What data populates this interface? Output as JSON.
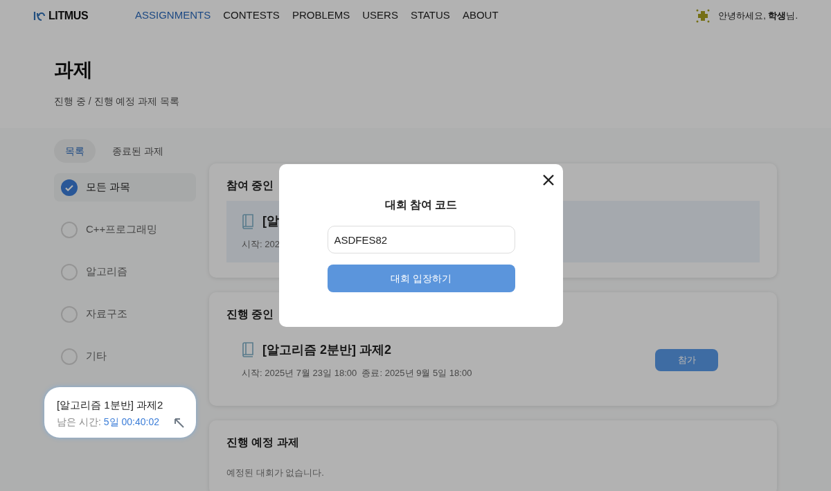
{
  "header": {
    "logo": "LITMUS",
    "nav": [
      {
        "label": "ASSIGNMENTS",
        "selected": true
      },
      {
        "label": "CONTESTS",
        "selected": false
      },
      {
        "label": "PROBLEMS",
        "selected": false
      },
      {
        "label": "USERS",
        "selected": false
      },
      {
        "label": "STATUS",
        "selected": false
      },
      {
        "label": "ABOUT",
        "selected": false
      }
    ],
    "greeting": "안녕하세요, **학생**님."
  },
  "page": {
    "title": "과제",
    "subtitle": "진행 중 / 진행 예정 과제 목록"
  },
  "tabs": [
    {
      "label": "목록",
      "selected": true
    },
    {
      "label": "종료된 과제",
      "selected": false
    }
  ],
  "filters": [
    {
      "label": "모든 과목",
      "checked": true
    },
    {
      "label": "C++프로그래밍",
      "checked": false
    },
    {
      "label": "알고리즘",
      "checked": false
    },
    {
      "label": "자료구조",
      "checked": false
    },
    {
      "label": "기타",
      "checked": false
    }
  ],
  "sections": [
    {
      "title": "참여 중인",
      "highlighted": true,
      "items": [
        {
          "title": "[알",
          "dates": "시작: 202"
        }
      ]
    },
    {
      "title": "진행 중인",
      "items": [
        {
          "title": "[알고리즘 2분반] 과제2",
          "dates": "시작: 2025년 7월 23일 18:00  종료: 2025년 9월 5일 18:00",
          "button": "참가"
        }
      ]
    },
    {
      "title": "진행 예정 과제",
      "empty_message": "예정된 대회가 없습니다."
    }
  ],
  "timer": {
    "title": "[알고리즘 1분반] 과제2",
    "label": "남은 시간:",
    "remaining": "5일 00:40:02"
  },
  "modal": {
    "title": "대회 참여 코드",
    "code": "ASDFES82",
    "submit": "대회 입장하기"
  }
}
